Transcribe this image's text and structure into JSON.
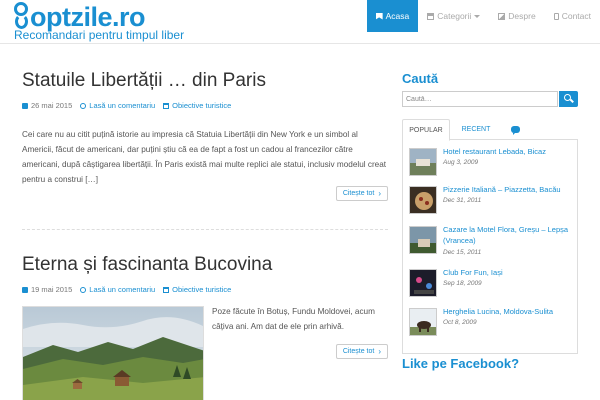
{
  "header": {
    "logo_text": "optzile.ro",
    "tagline": "Recomandari pentru timpul liber"
  },
  "nav": {
    "items": [
      {
        "label": "Acasa",
        "icon": "bookmark-icon",
        "active": true
      },
      {
        "label": "Categorii",
        "icon": "box-icon",
        "dropdown": true
      },
      {
        "label": "Despre",
        "icon": "image-icon"
      },
      {
        "label": "Contact",
        "icon": "phone-icon"
      }
    ]
  },
  "posts": [
    {
      "title": "Statuile Libertății … din Paris",
      "date": "26 mai 2015",
      "comment_link": "Lasă un comentariu",
      "category": "Obiective turistice",
      "excerpt": "Cei care nu au citit puțină istorie au impresia că Statuia Libertății din New York e un simbol al Americii, făcut de americani, dar puțini știu că ea de fapt a fost un cadou al francezilor către americani, după câștigarea libertății. În Paris există mai multe replici ale statui, inclusiv modelul creat pentru a construi […]",
      "read_more": "Citește tot"
    },
    {
      "title": "Eterna și fascinanta Bucovina",
      "date": "19 mai 2015",
      "comment_link": "Lasă un comentariu",
      "category": "Obiective turistice",
      "excerpt": "Poze făcute în Botuș, Fundu Moldovei, acum câțiva ani. Am dat de ele prin arhivă.",
      "read_more": "Citește tot"
    }
  ],
  "sidebar": {
    "search_heading": "Caută",
    "search_placeholder": "Caută…",
    "tabs": [
      {
        "label": "POPULAR",
        "active": true
      },
      {
        "label": "RECENT"
      },
      {
        "icon": "comments-icon"
      }
    ],
    "popular": [
      {
        "title": "Hotel restaurant Lebada, Bicaz",
        "date": "Aug 3, 2009"
      },
      {
        "title": "Pizzerie Italiană – Piazzetta, Bacău",
        "date": "Dec 31, 2011"
      },
      {
        "title": "Cazare la Motel Flora, Greșu – Lepșa (Vrancea)",
        "date": "Dec 15, 2011"
      },
      {
        "title": "Club For Fun, Iași",
        "date": "Sep 18, 2009"
      },
      {
        "title": "Herghelia Lucina, Moldova-Sulita",
        "date": "Oct 8, 2009"
      }
    ],
    "facebook_heading": "Like pe Facebook?"
  },
  "colors": {
    "accent": "#1a8fd1",
    "text": "#555555",
    "title": "#333333"
  }
}
